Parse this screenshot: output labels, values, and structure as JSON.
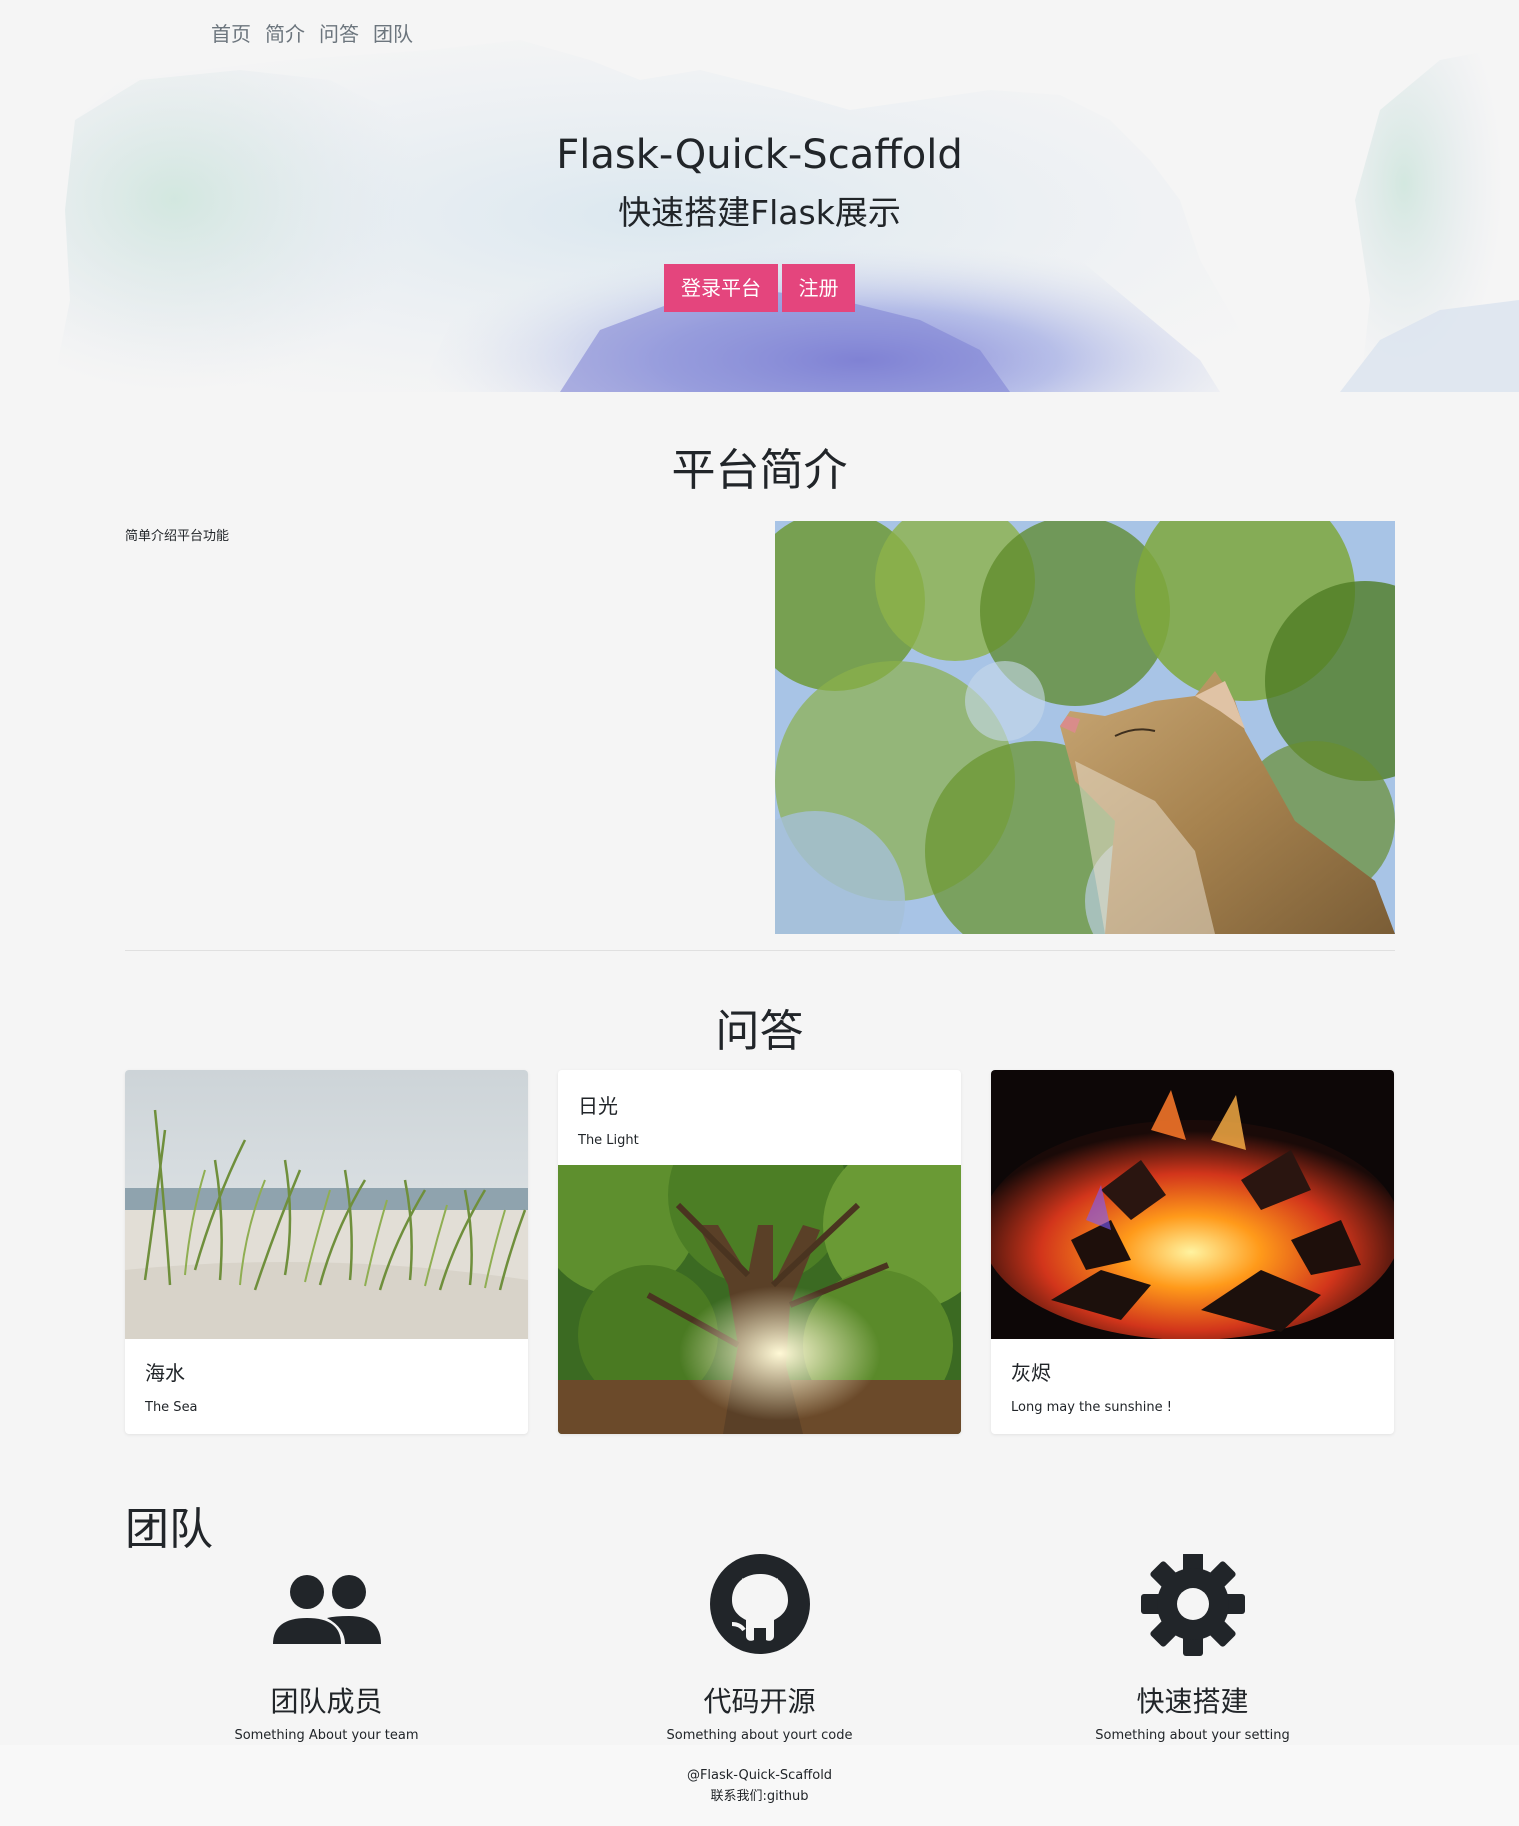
{
  "nav": {
    "items": [
      "首页",
      "简介",
      "问答",
      "团队"
    ]
  },
  "hero": {
    "title": "Flask-Quick-Scaffold",
    "subtitle": "快速搭建Flask展示",
    "login_label": "登录平台",
    "register_label": "注册",
    "accent_color": "#e4457d"
  },
  "intro": {
    "title": "平台简介",
    "text": "简单介绍平台功能"
  },
  "qa": {
    "title": "问答",
    "cards": [
      {
        "heading": "海水",
        "text": "The Sea"
      },
      {
        "heading": "日光",
        "text": "The Light"
      },
      {
        "heading": "灰烬",
        "text": "Long may the sunshine !"
      }
    ]
  },
  "team": {
    "title": "团队",
    "features": [
      {
        "icon": "people-icon",
        "heading": "团队成员",
        "text": "Something About your team"
      },
      {
        "icon": "github-icon",
        "heading": "代码开源",
        "text": "Something about yourt code"
      },
      {
        "icon": "gear-icon",
        "heading": "快速搭建",
        "text": "Something about your setting"
      }
    ]
  },
  "footer": {
    "line1": "@Flask-Quick-Scaffold",
    "line2": "联系我们:github"
  }
}
